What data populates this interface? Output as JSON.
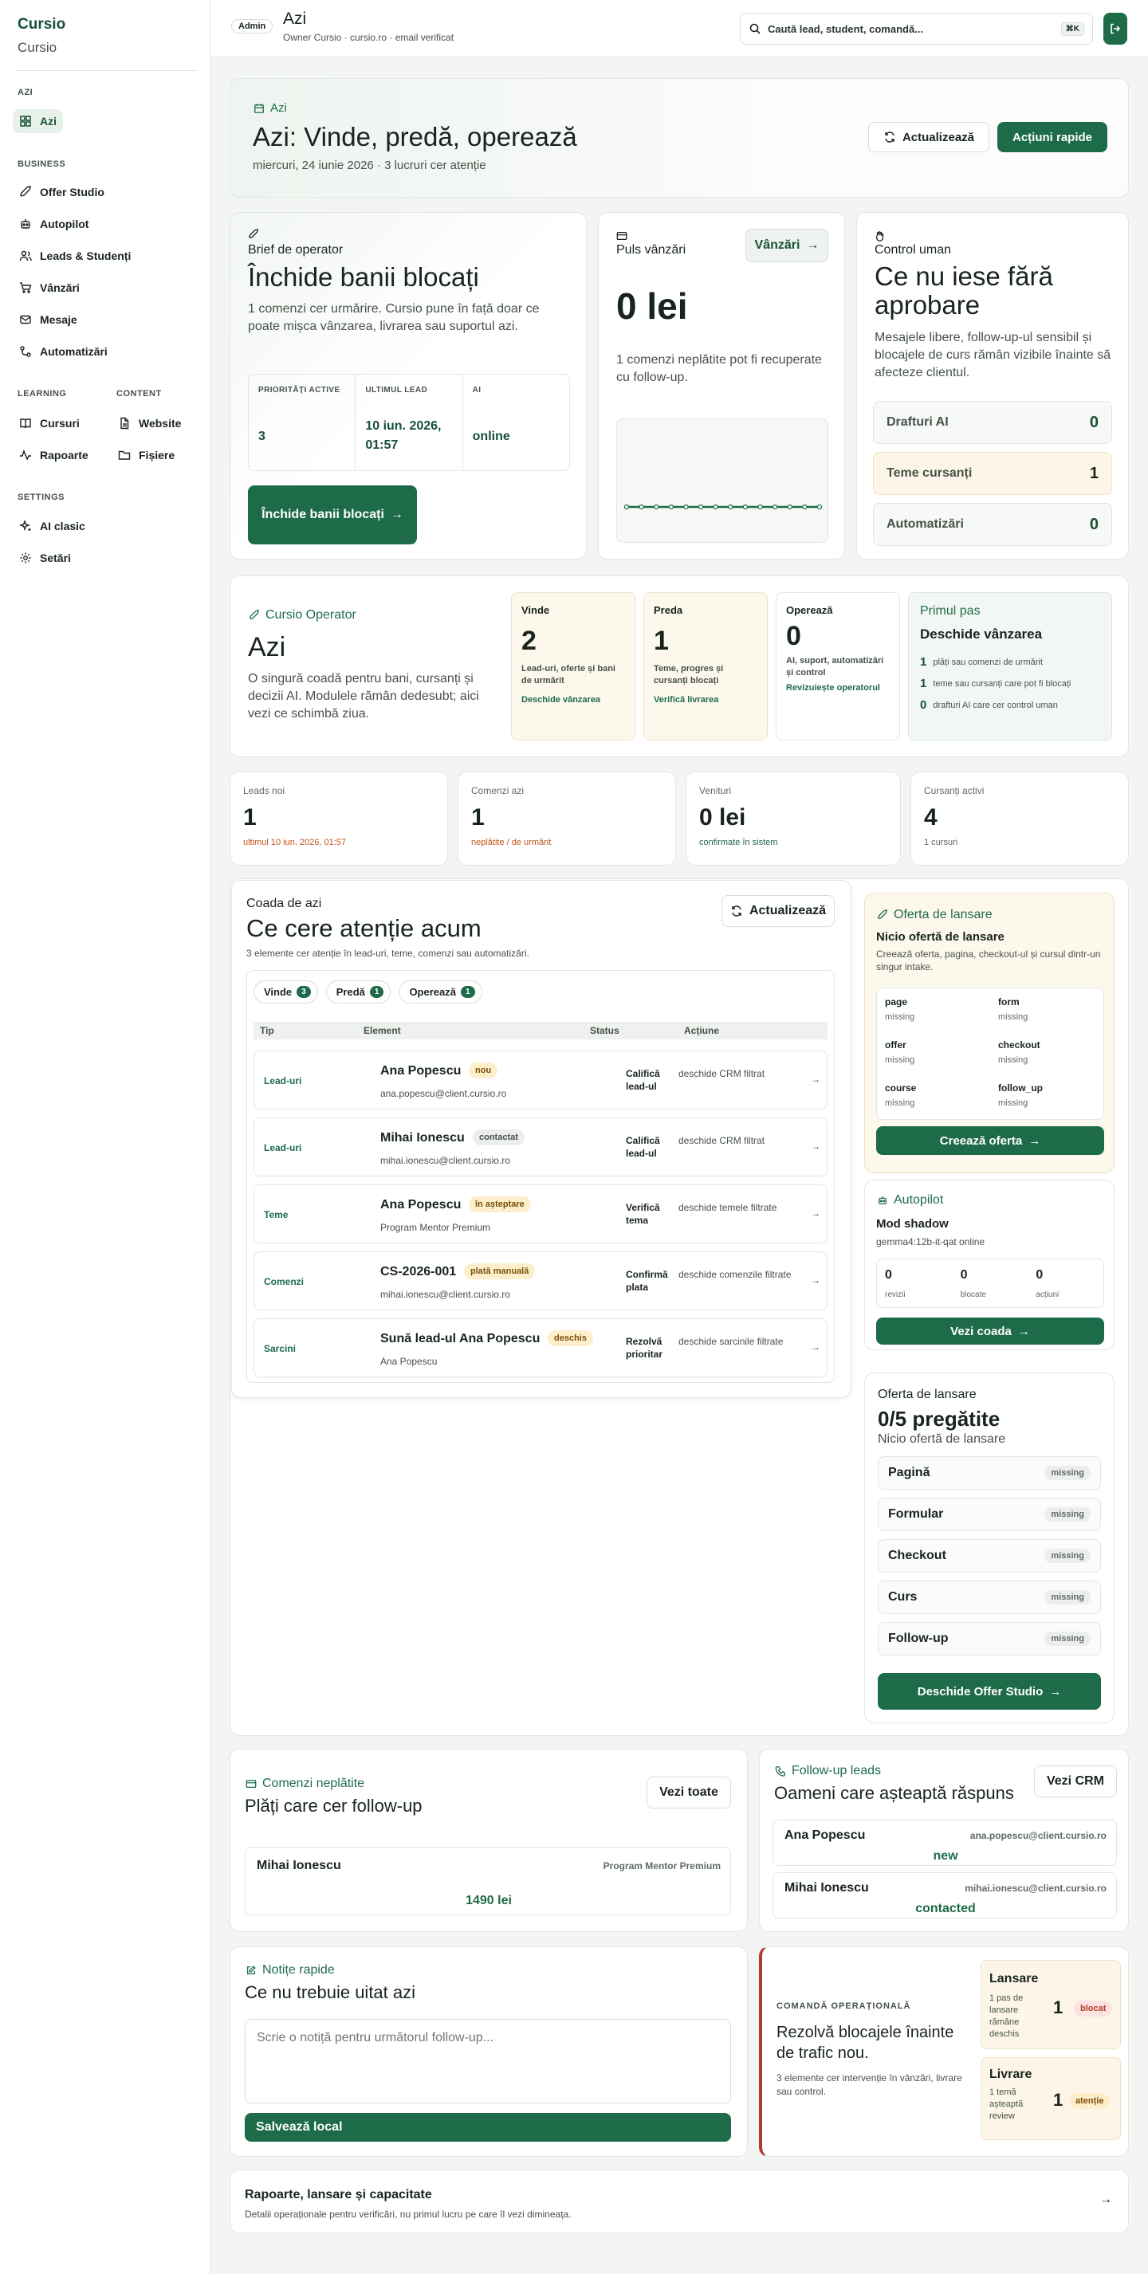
{
  "sidebar": {
    "brand": "Cursio",
    "subtitle": "Cursio",
    "sec_azi": "AZI",
    "item_azi": "Azi",
    "sec_business": "BUSINESS",
    "business": [
      "Offer Studio",
      "Autopilot",
      "Leads & Studenți",
      "Vânzări",
      "Mesaje",
      "Automatizări"
    ],
    "sec_learning": "LEARNING",
    "learning": [
      "Cursuri",
      "Rapoarte"
    ],
    "sec_content": "CONTENT",
    "content": [
      "Website",
      "Fișiere"
    ],
    "sec_settings": "SETTINGS",
    "settings": [
      "AI clasic",
      "Setări"
    ]
  },
  "topbar": {
    "badge": "Admin",
    "title": "Azi",
    "subtitle": "Owner Cursio · cursio.ro · email verificat",
    "search_placeholder": "Caută lead, student, comandă...",
    "shortcut": "⌘K"
  },
  "hero": {
    "eyebrow": "Azi",
    "title": "Azi: Vinde, predă, operează",
    "date": "miercuri, 24 iunie 2026 · 3 lucruri cer atenție",
    "refresh": "Actualizează",
    "quick": "Acțiuni rapide"
  },
  "brief": {
    "eyebrow": "Brief de operator",
    "title": "Închide banii blocați",
    "text": "1 comenzi cer urmărire. Cursio pune în față doar ce poate mișca vânzarea, livrarea sau suportul azi.",
    "stats": [
      {
        "label": "PRIORITĂȚI ACTIVE",
        "value": "3"
      },
      {
        "label": "ULTIMUL LEAD",
        "value": "10 iun. 2026, 01:57"
      },
      {
        "label": "AI",
        "value": "online"
      }
    ],
    "cta": "Închide banii blocați"
  },
  "pulse": {
    "eyebrow": "Puls vânzări",
    "button": "Vânzări",
    "amount": "0 lei",
    "text": "1 comenzi neplătite pot fi recuperate cu follow-up."
  },
  "human": {
    "eyebrow": "Control uman",
    "title": "Ce nu iese fără aprobare",
    "text": "Mesajele libere, follow-up-ul sensibil și blocajele de curs rămân vizibile înainte să afecteze clientul.",
    "rows": [
      {
        "label": "Drafturi AI",
        "value": "0"
      },
      {
        "label": "Teme cursanți",
        "value": "1"
      },
      {
        "label": "Automatizări",
        "value": "0"
      }
    ]
  },
  "operator": {
    "eyebrow": "Cursio Operator",
    "title": "Azi",
    "text": "O singură coadă pentru bani, cursanți și decizii AI. Modulele rămân dedesubt; aici vezi ce schimbă ziua.",
    "boxes": [
      {
        "title": "Vinde",
        "value": "2",
        "desc": "Lead-uri, oferte și bani de urmărit",
        "link": "Deschide vânzarea"
      },
      {
        "title": "Preda",
        "value": "1",
        "desc": "Teme, progres și cursanți blocați",
        "link": "Verifică livrarea"
      },
      {
        "title": "Operează",
        "value": "0",
        "desc": "AI, suport, automatizări și control",
        "link": "Revizuiește operatorul"
      }
    ],
    "first_eyebrow": "Primul pas",
    "first_title": "Deschide vânzarea",
    "first_items": [
      {
        "n": "1",
        "t": "plăți sau comenzi de urmărit"
      },
      {
        "n": "1",
        "t": "teme sau cursanți care pot fi blocați"
      },
      {
        "n": "0",
        "t": "drafturi AI care cer control uman"
      }
    ]
  },
  "kpis": [
    {
      "label": "Leads noi",
      "value": "1",
      "note": "ultimul 10 iun. 2026, 01:57"
    },
    {
      "label": "Comenzi azi",
      "value": "1",
      "note": "neplătite / de urmărit"
    },
    {
      "label": "Venituri",
      "value": "0 lei",
      "note": "confirmate în sistem"
    },
    {
      "label": "Cursanți activi",
      "value": "4",
      "note": "1 cursuri"
    }
  ],
  "queue": {
    "eyebrow": "Coada de azi",
    "title": "Ce cere atenție acum",
    "sub": "3 elemente cer atenție în lead-uri, teme, comenzi sau automatizări.",
    "refresh": "Actualizează",
    "tabs": [
      {
        "label": "Vinde",
        "count": "3"
      },
      {
        "label": "Predă",
        "count": "1"
      },
      {
        "label": "Operează",
        "count": "1"
      }
    ],
    "headers": [
      "Tip",
      "Element",
      "Status",
      "Acțiune"
    ],
    "rows": [
      {
        "type": "Lead-uri",
        "name": "Ana Popescu",
        "badge": "nou",
        "sub": "ana.popescu@client.cursio.ro",
        "status": "Califică lead-ul",
        "action": "deschide CRM filtrat"
      },
      {
        "type": "Lead-uri",
        "name": "Mihai Ionescu",
        "badge": "contactat",
        "sub": "mihai.ionescu@client.cursio.ro",
        "status": "Califică lead-ul",
        "action": "deschide CRM filtrat"
      },
      {
        "type": "Teme",
        "name": "Ana Popescu",
        "badge": "în așteptare",
        "sub": "Program Mentor Premium",
        "status": "Verifică tema",
        "action": "deschide temele filtrate"
      },
      {
        "type": "Comenzi",
        "name": "CS-2026-001",
        "badge": "plată manuală",
        "sub": "mihai.ionescu@client.cursio.ro",
        "status": "Confirmă plata",
        "action": "deschide comenzile filtrate"
      },
      {
        "type": "Sarcini",
        "name": "Sună lead-ul Ana Popescu",
        "badge": "deschis",
        "sub": "Ana Popescu",
        "status": "Rezolvă prioritar",
        "action": "deschide sarcinile filtrate"
      }
    ]
  },
  "offer": {
    "eyebrow": "Oferta de lansare",
    "title": "Nicio ofertă de lansare",
    "text": "Creează oferta, pagina, checkout-ul și cursul dintr-un singur intake.",
    "grid": [
      {
        "k": "page",
        "v": "missing"
      },
      {
        "k": "form",
        "v": "missing"
      },
      {
        "k": "offer",
        "v": "missing"
      },
      {
        "k": "checkout",
        "v": "missing"
      },
      {
        "k": "course",
        "v": "missing"
      },
      {
        "k": "follow_up",
        "v": "missing"
      }
    ],
    "cta": "Creează oferta"
  },
  "autopilot": {
    "eyebrow": "Autopilot",
    "title": "Mod shadow",
    "model": "gemma4:12b-it-qat online",
    "stats": [
      {
        "v": "0",
        "l": "revizii"
      },
      {
        "v": "0",
        "l": "blocate"
      },
      {
        "v": "0",
        "l": "acțiuni"
      }
    ],
    "cta": "Vezi coada"
  },
  "launch": {
    "eyebrow": "Oferta de lansare",
    "title": "0/5 pregătite",
    "sub": "Nicio ofertă de lansare",
    "items": [
      {
        "k": "Pagină",
        "v": "missing"
      },
      {
        "k": "Formular",
        "v": "missing"
      },
      {
        "k": "Checkout",
        "v": "missing"
      },
      {
        "k": "Curs",
        "v": "missing"
      },
      {
        "k": "Follow-up",
        "v": "missing"
      }
    ],
    "cta": "Deschide Offer Studio"
  },
  "unpaid": {
    "eyebrow": "Comenzi neplătite",
    "title": "Plăți care cer follow-up",
    "button": "Vezi toate",
    "name": "Mihai Ionescu",
    "program": "Program Mentor Premium",
    "amount": "1490 lei"
  },
  "follow": {
    "eyebrow": "Follow-up leads",
    "title": "Oameni care așteaptă răspuns",
    "button": "Vezi CRM",
    "rows": [
      {
        "name": "Ana Popescu",
        "email": "ana.popescu@client.cursio.ro",
        "status": "new"
      },
      {
        "name": "Mihai Ionescu",
        "email": "mihai.ionescu@client.cursio.ro",
        "status": "contacted"
      }
    ]
  },
  "notes": {
    "eyebrow": "Notițe rapide",
    "title": "Ce nu trebuie uitat azi",
    "placeholder": "Scrie o notiță pentru următorul follow-up...",
    "cta": "Salvează local"
  },
  "command": {
    "eyebrow": "COMANDĂ OPERAȚIONALĂ",
    "title": "Rezolvă blocajele înainte de trafic nou.",
    "text": "3 elemente cer intervenție în vânzări, livrare sau control.",
    "items": [
      {
        "title": "Lansare",
        "desc": "1 pas de lansare rămâne deschis",
        "value": "1",
        "badge": "blocat"
      },
      {
        "title": "Livrare",
        "desc": "1 temă așteaptă review",
        "value": "1",
        "badge": "atenție"
      }
    ]
  },
  "footer": {
    "title": "Rapoarte, lansare și capacitate",
    "text": "Detalii operaționale pentru verificări, nu primul lucru pe care îl vezi dimineața."
  },
  "colors": {
    "accent": "#1e6b4a",
    "accent_dark": "#174f37",
    "warning_bg": "#fdf6e8",
    "danger": "#b63a2a"
  }
}
